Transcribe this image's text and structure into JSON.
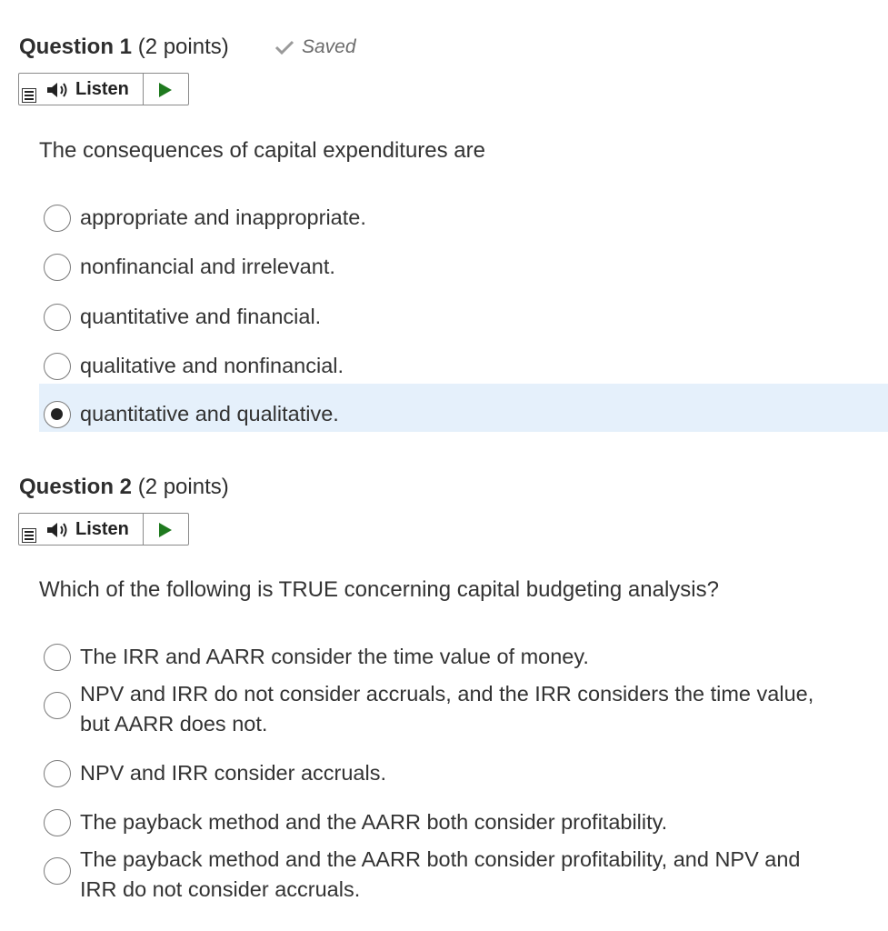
{
  "q1": {
    "title": "Question 1",
    "points": "(2 points)",
    "saved": "Saved",
    "listen": "Listen",
    "prompt": "The consequences of capital expenditures are",
    "options": [
      "appropriate and inappropriate.",
      "nonfinancial and irrelevant.",
      "quantitative and financial.",
      "qualitative and nonfinancial.",
      "quantitative and qualitative."
    ],
    "selected_index": 4
  },
  "q2": {
    "title": "Question 2",
    "points": "(2 points)",
    "listen": "Listen",
    "prompt": "Which of the following is TRUE concerning capital budgeting analysis?",
    "options": [
      "The IRR and AARR consider the time value of money.",
      "NPV and IRR do not consider accruals, and the IRR considers the time value,",
      "but AARR does not.",
      "NPV and IRR consider accruals.",
      "The payback method and the AARR both consider profitability.",
      "The payback method and the AARR both consider profitability, and NPV and",
      "IRR do not consider accruals."
    ]
  },
  "colors": {
    "selected_bg": "#e5f0fb",
    "play_green": "#1f7a1f"
  },
  "icons": [
    "checkmark-icon",
    "menu-icon",
    "speaker-icon",
    "play-icon",
    "radio-icon"
  ]
}
